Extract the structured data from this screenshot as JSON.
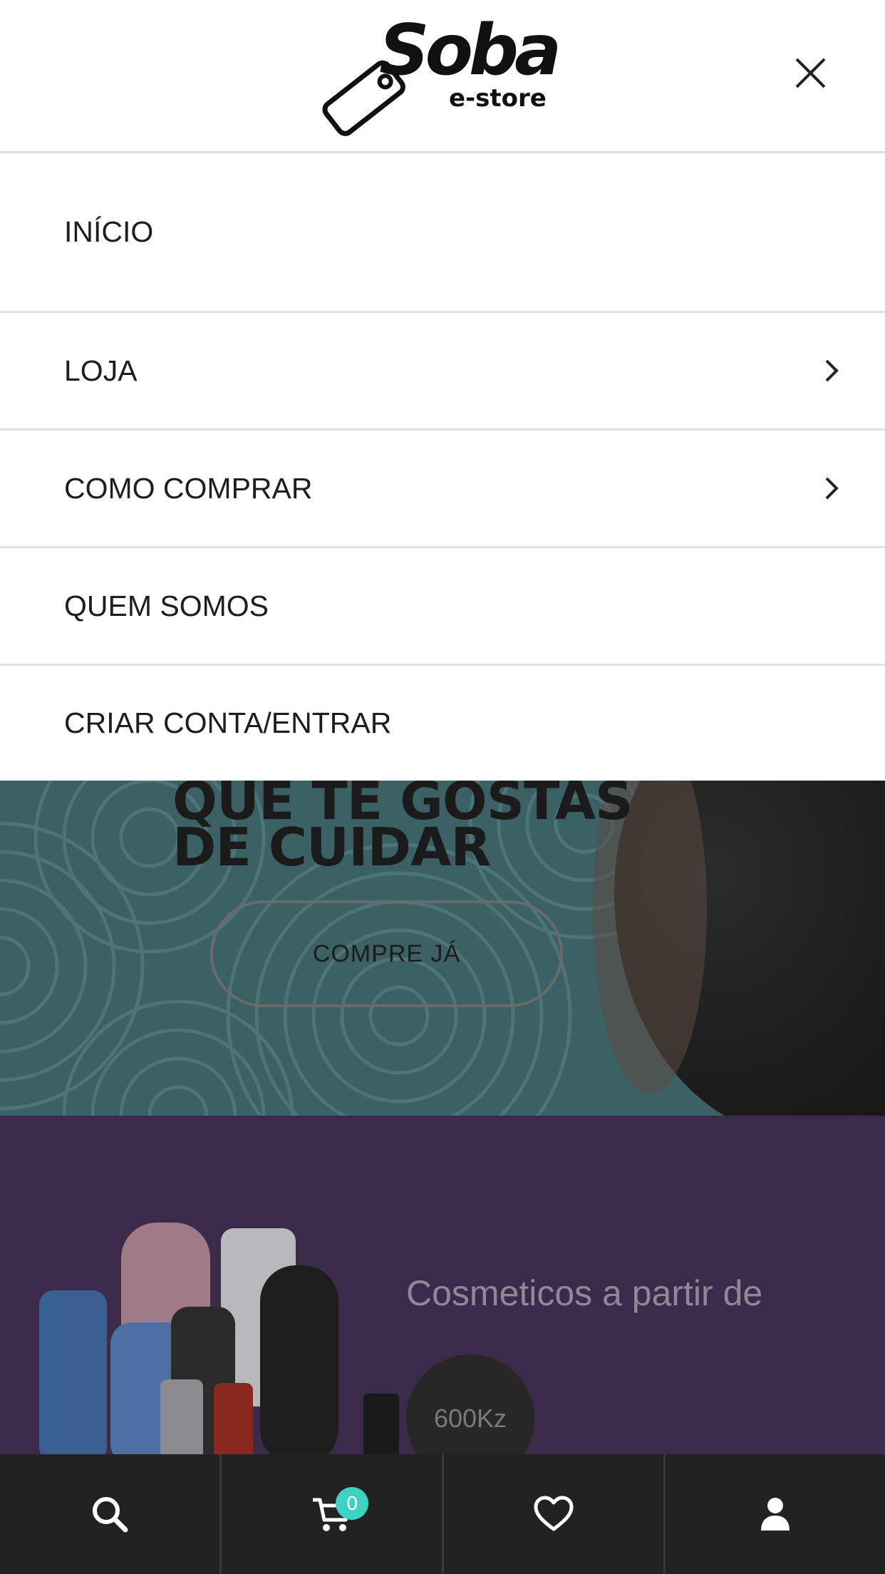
{
  "header": {
    "logo_main": "Soba",
    "logo_sub": "e-store",
    "close_icon": "close-icon"
  },
  "menu": {
    "items": [
      {
        "label": "INÍCIO",
        "has_submenu": false
      },
      {
        "label": "LOJA",
        "has_submenu": true
      },
      {
        "label": "COMO COMPRAR",
        "has_submenu": true
      },
      {
        "label": "QUEM SOMOS",
        "has_submenu": false
      },
      {
        "label": "CRIAR CONTA/ENTRAR",
        "has_submenu": false
      }
    ]
  },
  "hero": {
    "title_line1": "QUE TE GOSTAS",
    "title_line2": "DE CUIDAR",
    "button_label": "COMPRE JÁ",
    "background_color": "#3b6165"
  },
  "promo": {
    "text": "Cosmeticos a partir de",
    "price": "600Kz",
    "background_color": "#3c2a4b"
  },
  "bottom_bar": {
    "items": [
      {
        "icon": "search-icon"
      },
      {
        "icon": "cart-icon",
        "badge": "0"
      },
      {
        "icon": "heart-icon"
      },
      {
        "icon": "user-icon"
      }
    ],
    "badge_color": "#3fd1c1"
  }
}
